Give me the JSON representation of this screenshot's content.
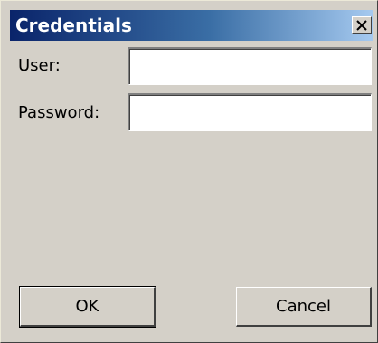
{
  "window": {
    "title": "Credentials",
    "close_glyph": "X"
  },
  "form": {
    "user_label": "User:",
    "user_value": "",
    "password_label": "Password:",
    "password_value": ""
  },
  "buttons": {
    "ok_label": "OK",
    "cancel_label": "Cancel"
  },
  "colors": {
    "title_gradient_start": "#0a246a",
    "title_gradient_end": "#a6caf0",
    "dialog_background": "#d4d0c8"
  }
}
